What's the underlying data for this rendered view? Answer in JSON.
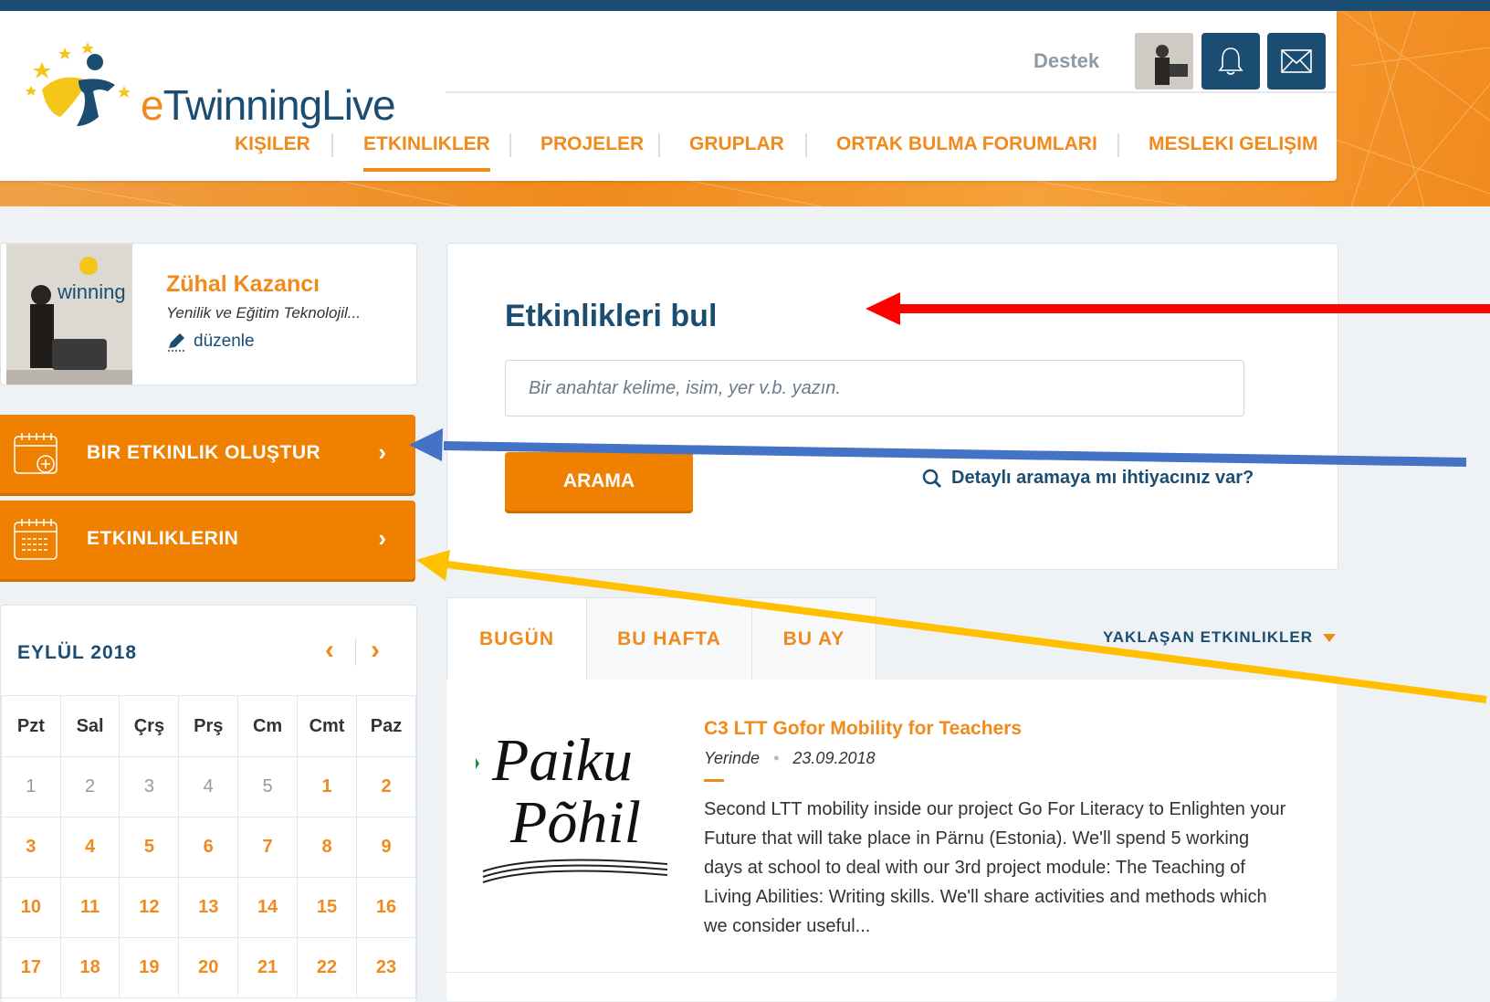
{
  "header": {
    "logo_prefix": "e",
    "logo_rest": "TwinningLive",
    "support": "Destek",
    "nav": [
      "KIŞILER",
      "ETKINLIKLER",
      "PROJELER",
      "GRUPLAR",
      "ORTAK BULMA FORUMLARI",
      "MESLEKI GELIŞIM"
    ],
    "active_nav": "ETKINLIKLER"
  },
  "profile": {
    "name": "Zühal Kazancı",
    "role": "Yenilik ve Eğitim Teknolojil...",
    "edit": "düzenle",
    "photo_caption": "winning"
  },
  "actions": {
    "create_event": "BIR ETKINLIK OLUŞTUR",
    "my_events": "ETKINLIKLERIN"
  },
  "calendar": {
    "title": "EYLÜL 2018",
    "days": [
      "Pzt",
      "Sal",
      "Çrş",
      "Prş",
      "Cm",
      "Cmt",
      "Paz"
    ],
    "weeks": [
      [
        "1",
        "2",
        "3",
        "4",
        "5",
        "1",
        "2"
      ],
      [
        "3",
        "4",
        "5",
        "6",
        "7",
        "8",
        "9"
      ],
      [
        "10",
        "11",
        "12",
        "13",
        "14",
        "15",
        "16"
      ],
      [
        "17",
        "18",
        "19",
        "20",
        "21",
        "22",
        "23"
      ]
    ]
  },
  "search": {
    "title": "Etkinlikleri bul",
    "placeholder": "Bir anahtar kelime, isim, yer v.b. yazın.",
    "button": "ARAMA",
    "advanced": "Detaylı aramaya mı ihtiyacınız var?"
  },
  "tabs": {
    "items": [
      "BUGÜN",
      "BU HAFTA",
      "BU AY"
    ],
    "active": "BUGÜN",
    "filter": "YAKLAŞAN ETKINLIKLER"
  },
  "event": {
    "title": "C3 LTT Gofor Mobility for Teachers",
    "location": "Yerinde",
    "date": "23.09.2018",
    "description": "Second LTT mobility inside our project Go For Literacy to Enlighten your Future that will take place in Pärnu (Estonia). We'll spend 5 working days at school to deal with our 3rd project module: The Teaching of Living Abilities: Writing skills. We'll share activities and methods which we consider useful...",
    "image_text_1": "Paiku",
    "image_text_2": "Põhil"
  },
  "colors": {
    "navy": "#1b4d73",
    "orange": "#f08000",
    "arrow_red": "#ff0000",
    "arrow_blue": "#4472c4",
    "arrow_yellow": "#ffc000"
  }
}
